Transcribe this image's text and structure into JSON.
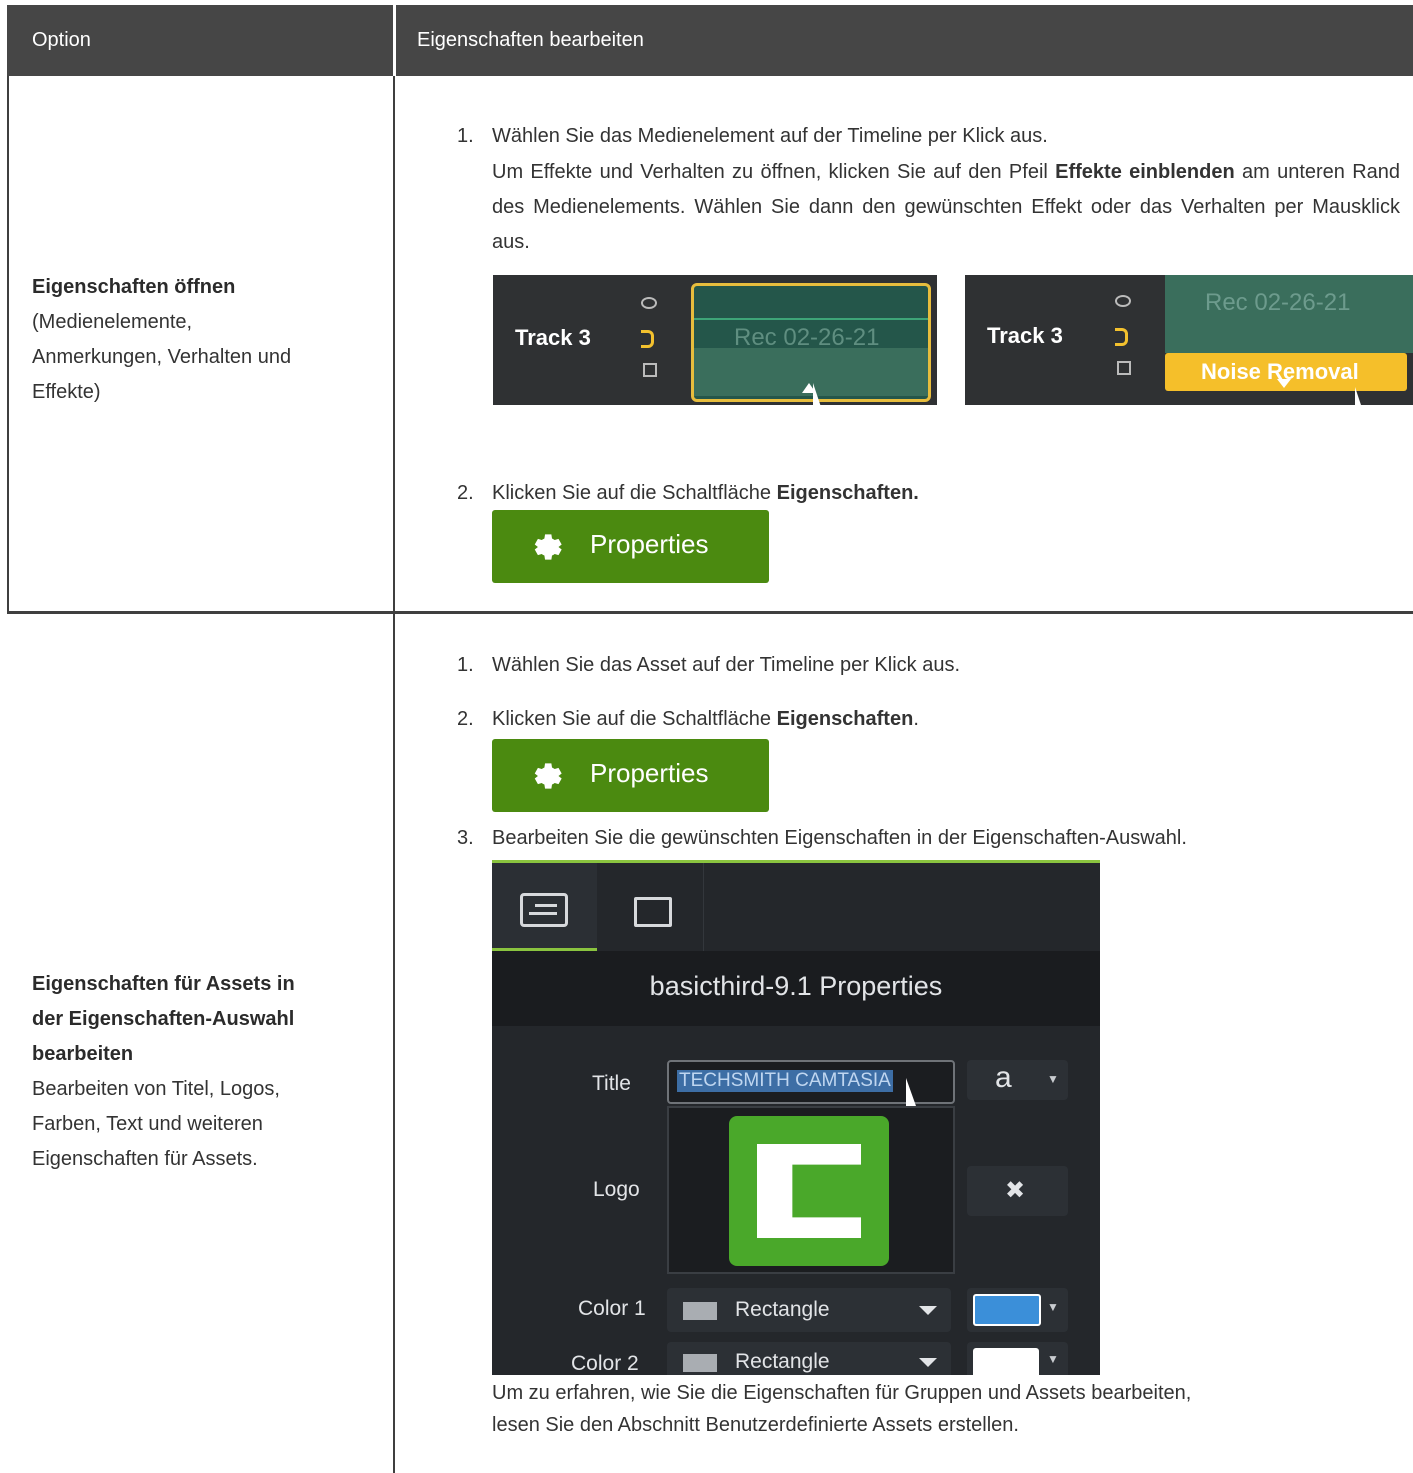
{
  "header": {
    "col1": "Option",
    "col2": "Eigenschaften bearbeiten"
  },
  "row1": {
    "title": "Eigenschaften öffnen",
    "desc_lines": [
      "(Medienelemente,",
      "Anmerkungen, Verhalten und",
      "Effekte)"
    ],
    "step1_num": "1.",
    "step1": "Wählen Sie das Medienelement auf der Timeline per Klick aus.",
    "para_pre": "Um Effekte und Verhalten zu öffnen, klicken Sie auf den Pfeil ",
    "para_bold": "Effekte einblenden",
    "para_post": " am unteren Rand des Medienelements. Wählen Sie dann den gewünschten Effekt oder das Verhalten per Mausklick aus.",
    "track_a_label": "Track 3",
    "track_a_clip": "Rec 02-26-21",
    "track_b_label": "Track 3",
    "track_b_clip": "Rec 02-26-21",
    "track_b_effect": "Noise Removal",
    "step2_num": "2.",
    "step2_pre": "Klicken Sie auf die Schaltfläche ",
    "step2_bold": "Eigenschaften.",
    "button_label": "Properties"
  },
  "row2": {
    "title_lines": [
      "Eigenschaften für Assets in",
      "der Eigenschaften-Auswahl",
      "bearbeiten"
    ],
    "desc_lines": [
      "Bearbeiten von Titel, Logos,",
      "Farben, Text und weiteren",
      "Eigenschaften für Assets."
    ],
    "step1_num": "1.",
    "step1": "Wählen Sie das Asset auf der Timeline per Klick aus.",
    "step2_num": "2.",
    "step2_pre": "Klicken Sie auf die Schaltfläche ",
    "step2_bold": "Eigenschaften",
    "step2_post": ".",
    "button_label": "Properties",
    "step3_num": "3.",
    "step3": "Bearbeiten Sie die gewünschten Eigenschaften in der Eigenschaften-Auswahl.",
    "panel": {
      "title": "basicthird-9.1 Properties",
      "title_label": "Title",
      "title_value": "TECHSMITH CAMTASIA",
      "font_glyph": "a",
      "logo_label": "Logo",
      "color1_label": "Color 1",
      "color1_shape": "Rectangle",
      "color1_swatch": "#3b8fd9",
      "color2_label": "Color 2",
      "color2_shape": "Rectangle",
      "color2_swatch": "#ffffff"
    },
    "footer_lines": [
      "Um zu erfahren, wie Sie die Eigenschaften für Gruppen und Assets bearbeiten,",
      "lesen Sie den Abschnitt Benutzerdefinierte Assets erstellen."
    ]
  }
}
